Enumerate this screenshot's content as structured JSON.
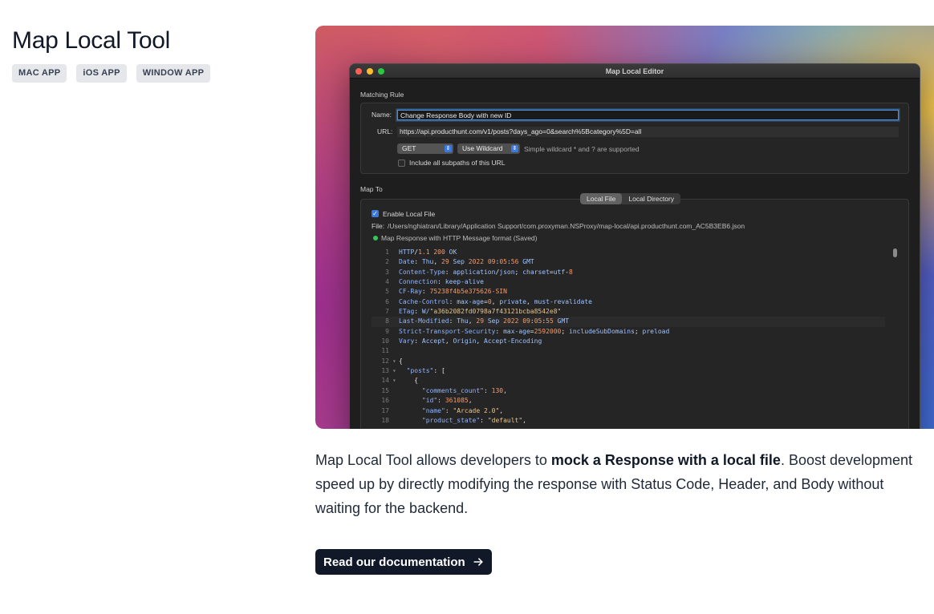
{
  "page": {
    "title": "Map Local Tool",
    "tags": [
      "MAC APP",
      "iOS APP",
      "WINDOW APP"
    ]
  },
  "editor": {
    "window_title": "Map Local Editor",
    "matching_rule_label": "Matching Rule",
    "name_label": "Name:",
    "name_value": "Change Response Body with new ID",
    "url_label": "URL:",
    "url_value": "https://api.producthunt.com/v1/posts?days_ago=0&search%5Bcategory%5D=all",
    "method": "GET",
    "match_mode": "Use Wildcard",
    "wildcard_hint": "Simple wildcard * and ? are supported",
    "include_subpaths_label": "Include all subpaths of this URL",
    "include_subpaths_checked": false,
    "map_to_label": "Map To",
    "tabs": [
      "Local File",
      "Local Directory"
    ],
    "active_tab": "Local File",
    "enable_local_file_label": "Enable Local File",
    "enable_local_file_checked": true,
    "file_label": "File:",
    "file_path": "/Users/nghiatran/Library/Application Support/com.proxyman.NSProxy/map-local/api.producthunt.com_AC5B3EB6.json",
    "status_text": "Map Response with HTTP Message format (Saved)",
    "status_color": "#34c759",
    "code_lines": [
      {
        "n": "1",
        "fold": "",
        "html": "<span class='tx'>HTTP</span><span class='k-sym'>/</span><span class='k-num'>1.1 200</span> <span class='tx'>OK</span>"
      },
      {
        "n": "2",
        "fold": "",
        "html": "<span class='k-key'>Date</span><span class='k-sym'>:</span> <span class='tx'>Thu</span><span class='k-sym'>,</span> <span class='k-num'>29</span> <span class='tx'>Sep</span> <span class='k-num'>2022 09</span><span class='k-sym'>:</span><span class='k-num'>05</span><span class='k-sym'>:</span><span class='k-num'>56</span> <span class='tx'>GMT</span>"
      },
      {
        "n": "3",
        "fold": "",
        "html": "<span class='k-key'>Content-Type</span><span class='k-sym'>:</span> <span class='tx'>application</span><span class='k-sym'>/</span><span class='tx'>json</span><span class='k-sym'>;</span> <span class='tx'>charset</span><span class='k-sym'>=</span><span class='tx'>utf</span><span class='k-sym'>-</span><span class='k-num'>8</span>"
      },
      {
        "n": "4",
        "fold": "",
        "html": "<span class='k-key'>Connection</span><span class='k-sym'>:</span> <span class='tx'>keep-alive</span>"
      },
      {
        "n": "5",
        "fold": "",
        "html": "<span class='k-key'>CF-Ray</span><span class='k-sym'>:</span> <span class='k-num'>75238f4b5e375626-SIN</span>"
      },
      {
        "n": "6",
        "fold": "",
        "html": "<span class='k-key'>Cache-Control</span><span class='k-sym'>:</span> <span class='tx'>max-age</span><span class='k-sym'>=</span><span class='k-num'>0</span><span class='k-sym'>,</span> <span class='tx'>private</span><span class='k-sym'>,</span> <span class='tx'>must-revalidate</span>"
      },
      {
        "n": "7",
        "fold": "",
        "html": "<span class='k-key'>ETag</span><span class='k-sym'>:</span> <span class='tx'>W/</span><span class='k-str'>\"a36b2082fd0798a7f43121bcba8542e8\"</span>"
      },
      {
        "n": "8",
        "fold": "",
        "hl": true,
        "html": "<span class='k-key'>Last-Modified</span><span class='k-sym'>:</span> <span class='tx'>Thu</span><span class='k-sym'>,</span> <span class='k-num'>29</span> <span class='tx'>Sep</span> <span class='k-num'>2022 09</span><span class='k-sym'>:</span><span class='k-num'>05</span><span class='k-sym'>:</span><span class='k-num'>55</span> <span class='tx'>GMT</span>"
      },
      {
        "n": "9",
        "fold": "",
        "html": "<span class='k-key'>Strict-Transport-Security</span><span class='k-sym'>:</span> <span class='tx'>max-age</span><span class='k-sym'>=</span><span class='k-num'>2592000</span><span class='k-sym'>;</span> <span class='tx'>includeSubDomains</span><span class='k-sym'>;</span> <span class='tx'>preload</span>"
      },
      {
        "n": "10",
        "fold": "",
        "html": "<span class='k-key'>Vary</span><span class='k-sym'>:</span> <span class='tx'>Accept</span><span class='k-sym'>,</span> <span class='tx'>Origin</span><span class='k-sym'>,</span> <span class='tx'>Accept-Encoding</span>"
      },
      {
        "n": "11",
        "fold": "",
        "html": ""
      },
      {
        "n": "12",
        "fold": "▾",
        "html": "<span class='k-sym'>{</span>"
      },
      {
        "n": "13",
        "fold": "▾",
        "html": "  <span class='k-key'>\"posts\"</span><span class='k-sym'>: [</span>"
      },
      {
        "n": "14",
        "fold": "▾",
        "html": "    <span class='k-sym'>{</span>"
      },
      {
        "n": "15",
        "fold": "",
        "html": "      <span class='k-key'>\"comments_count\"</span><span class='k-sym'>:</span> <span class='k-num'>130</span><span class='k-sym'>,</span>"
      },
      {
        "n": "16",
        "fold": "",
        "html": "      <span class='k-key'>\"id\"</span><span class='k-sym'>:</span> <span class='k-num'>361085</span><span class='k-sym'>,</span>"
      },
      {
        "n": "17",
        "fold": "",
        "html": "      <span class='k-key'>\"name\"</span><span class='k-sym'>:</span> <span class='k-str'>\"Arcade 2.0\"</span><span class='k-sym'>,</span>"
      },
      {
        "n": "18",
        "fold": "",
        "html": "      <span class='k-key'>\"product_state\"</span><span class='k-sym'>:</span> <span class='k-str'>\"default\"</span><span class='k-sym'>,</span>"
      }
    ]
  },
  "description": {
    "part1": "Map Local Tool allows developers to ",
    "bold": "mock a Response with a local file",
    "part2": ". Boost development speed up by directly modifying the response with Status Code, Header, and Body without waiting for the backend."
  },
  "cta": {
    "label": "Read our documentation",
    "icon": "arrow-right-icon"
  }
}
